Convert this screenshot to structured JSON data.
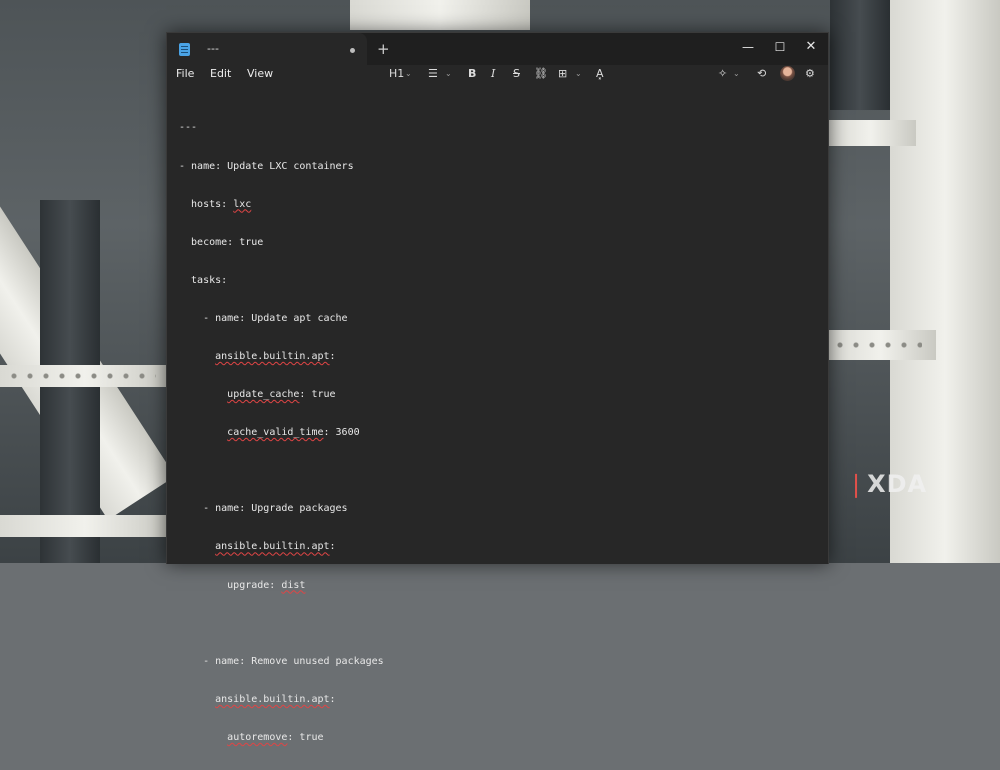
{
  "window": {
    "tab_title": "---",
    "new_tab": "+",
    "controls": {
      "minimize": "—",
      "maximize": "☐",
      "close": "✕"
    }
  },
  "menu": {
    "file": "File",
    "edit": "Edit",
    "view": "View"
  },
  "toolbar": {
    "heading": "H1",
    "list": "☰",
    "bold": "B",
    "italic": "I",
    "strike": "S",
    "link": "⛓",
    "table": "⊞",
    "spellcheck": "A͓",
    "copilot": "✧",
    "share": "⟲",
    "settings": "⚙",
    "caret": "⌄"
  },
  "document": {
    "lines": [
      "---",
      "- name: Update LXC containers",
      "  hosts: lxc",
      "  become: true",
      "  tasks:",
      "    - name: Update apt cache",
      "      ansible.builtin.apt:",
      "        update_cache: true",
      "        cache_valid_time: 3600",
      "",
      "    - name: Upgrade packages",
      "      ansible.builtin.apt:",
      "        upgrade: dist",
      "",
      "    - name: Remove unused packages",
      "      ansible.builtin.apt:",
      "        autoremove: true"
    ]
  },
  "watermark": {
    "mark": "X",
    "text": "XDA"
  },
  "icons": [
    "notepad-icon",
    "list-icon",
    "link-icon",
    "table-icon",
    "spellcheck-icon",
    "copilot-icon",
    "share-icon",
    "settings-icon"
  ]
}
